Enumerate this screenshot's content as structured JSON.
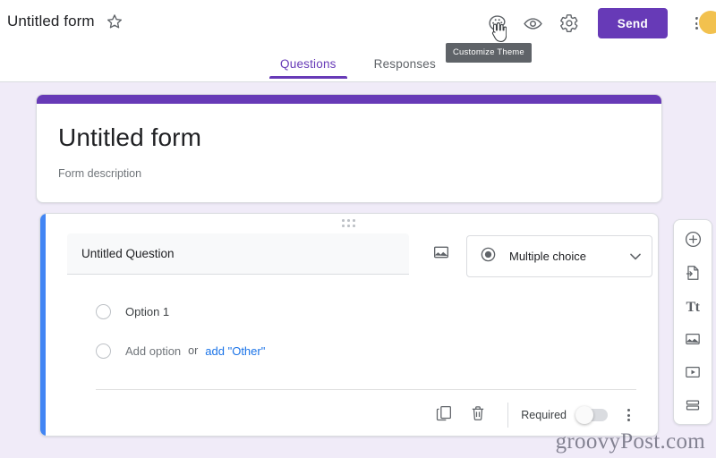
{
  "topbar": {
    "form_title": "Untitled form",
    "star_icon": "star-outline-icon",
    "palette_icon": "palette-icon",
    "preview_icon": "eye-preview-icon",
    "settings_icon": "gear-settings-icon",
    "send_label": "Send",
    "more_icon": "three-dot-menu-icon",
    "tooltip": "Customize Theme",
    "accent_color": "#673ab7"
  },
  "tabs": [
    {
      "label": "Questions",
      "active": true
    },
    {
      "label": "Responses",
      "active": false
    }
  ],
  "form_header": {
    "title": "Untitled form",
    "description": "Form description",
    "accent_color": "#673ab7"
  },
  "question": {
    "selected_color": "#4285f4",
    "title": "Untitled Question",
    "add_image_icon": "image-icon",
    "type": {
      "icon": "radio-filled-icon",
      "label": "Multiple choice",
      "chevron": "chevron-down-icon"
    },
    "options": [
      {
        "label": "Option 1",
        "muted": false
      }
    ],
    "add_option": {
      "label": "Add option",
      "or": "or",
      "other_link": "add \"Other\"",
      "link_color": "#1a73e8"
    },
    "footer": {
      "duplicate_icon": "duplicate-icon",
      "delete_icon": "trash-delete-icon",
      "required_label": "Required",
      "required_on": false,
      "more_icon": "three-dot-menu-icon"
    }
  },
  "side_toolbar": [
    {
      "name": "add-question",
      "icon": "plus-circle-icon"
    },
    {
      "name": "import-questions",
      "icon": "import-file-icon"
    },
    {
      "name": "add-title-description",
      "icon": "title-text-icon",
      "glyph": "Tt"
    },
    {
      "name": "add-image",
      "icon": "image-icon"
    },
    {
      "name": "add-video",
      "icon": "video-play-icon"
    },
    {
      "name": "add-section",
      "icon": "add-section-icon"
    }
  ],
  "watermark": "groovyPost.com"
}
